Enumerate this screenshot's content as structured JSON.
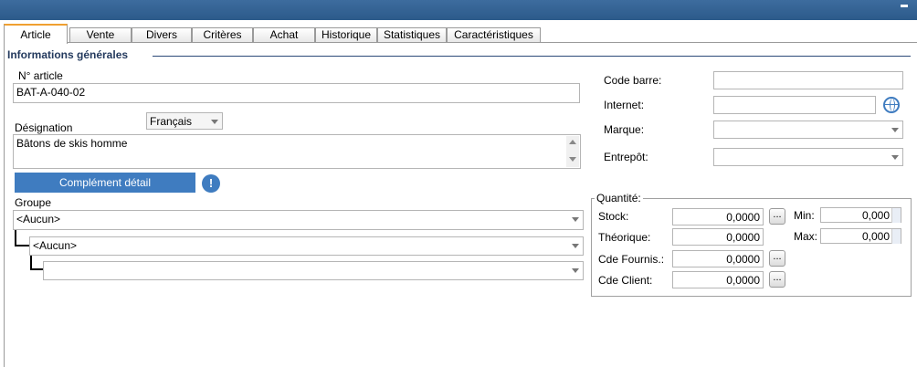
{
  "tabs": [
    "Article",
    "Vente",
    "Divers",
    "Critères",
    "Achat",
    "Historique",
    "Statistiques",
    "Caractéristiques"
  ],
  "section_title": "Informations générales",
  "article": {
    "number_label": "N° article",
    "number_value": "BAT-A-040-02",
    "designation_label": "Désignation",
    "language_value": "Français",
    "designation_value": "Bâtons de skis homme",
    "complement_button": "Complément détail",
    "info_icon": "!"
  },
  "groupe": {
    "label": "Groupe",
    "level1": "<Aucun>",
    "level2": "<Aucun>",
    "level3": ""
  },
  "right": {
    "code_barre_label": "Code barre:",
    "internet_label": "Internet:",
    "marque_label": "Marque:",
    "entrepot_label": "Entrepôt:"
  },
  "quantite": {
    "legend": "Quantité:",
    "stock_label": "Stock:",
    "stock_value": "0,0000",
    "theorique_label": "Théorique:",
    "theorique_value": "0,0000",
    "cde_fournis_label": "Cde Fournis.:",
    "cde_fournis_value": "0,0000",
    "cde_client_label": "Cde Client:",
    "cde_client_value": "0,0000",
    "min_label": "Min:",
    "min_value": "0,000",
    "max_label": "Max:",
    "max_value": "0,000",
    "dots": "..."
  }
}
